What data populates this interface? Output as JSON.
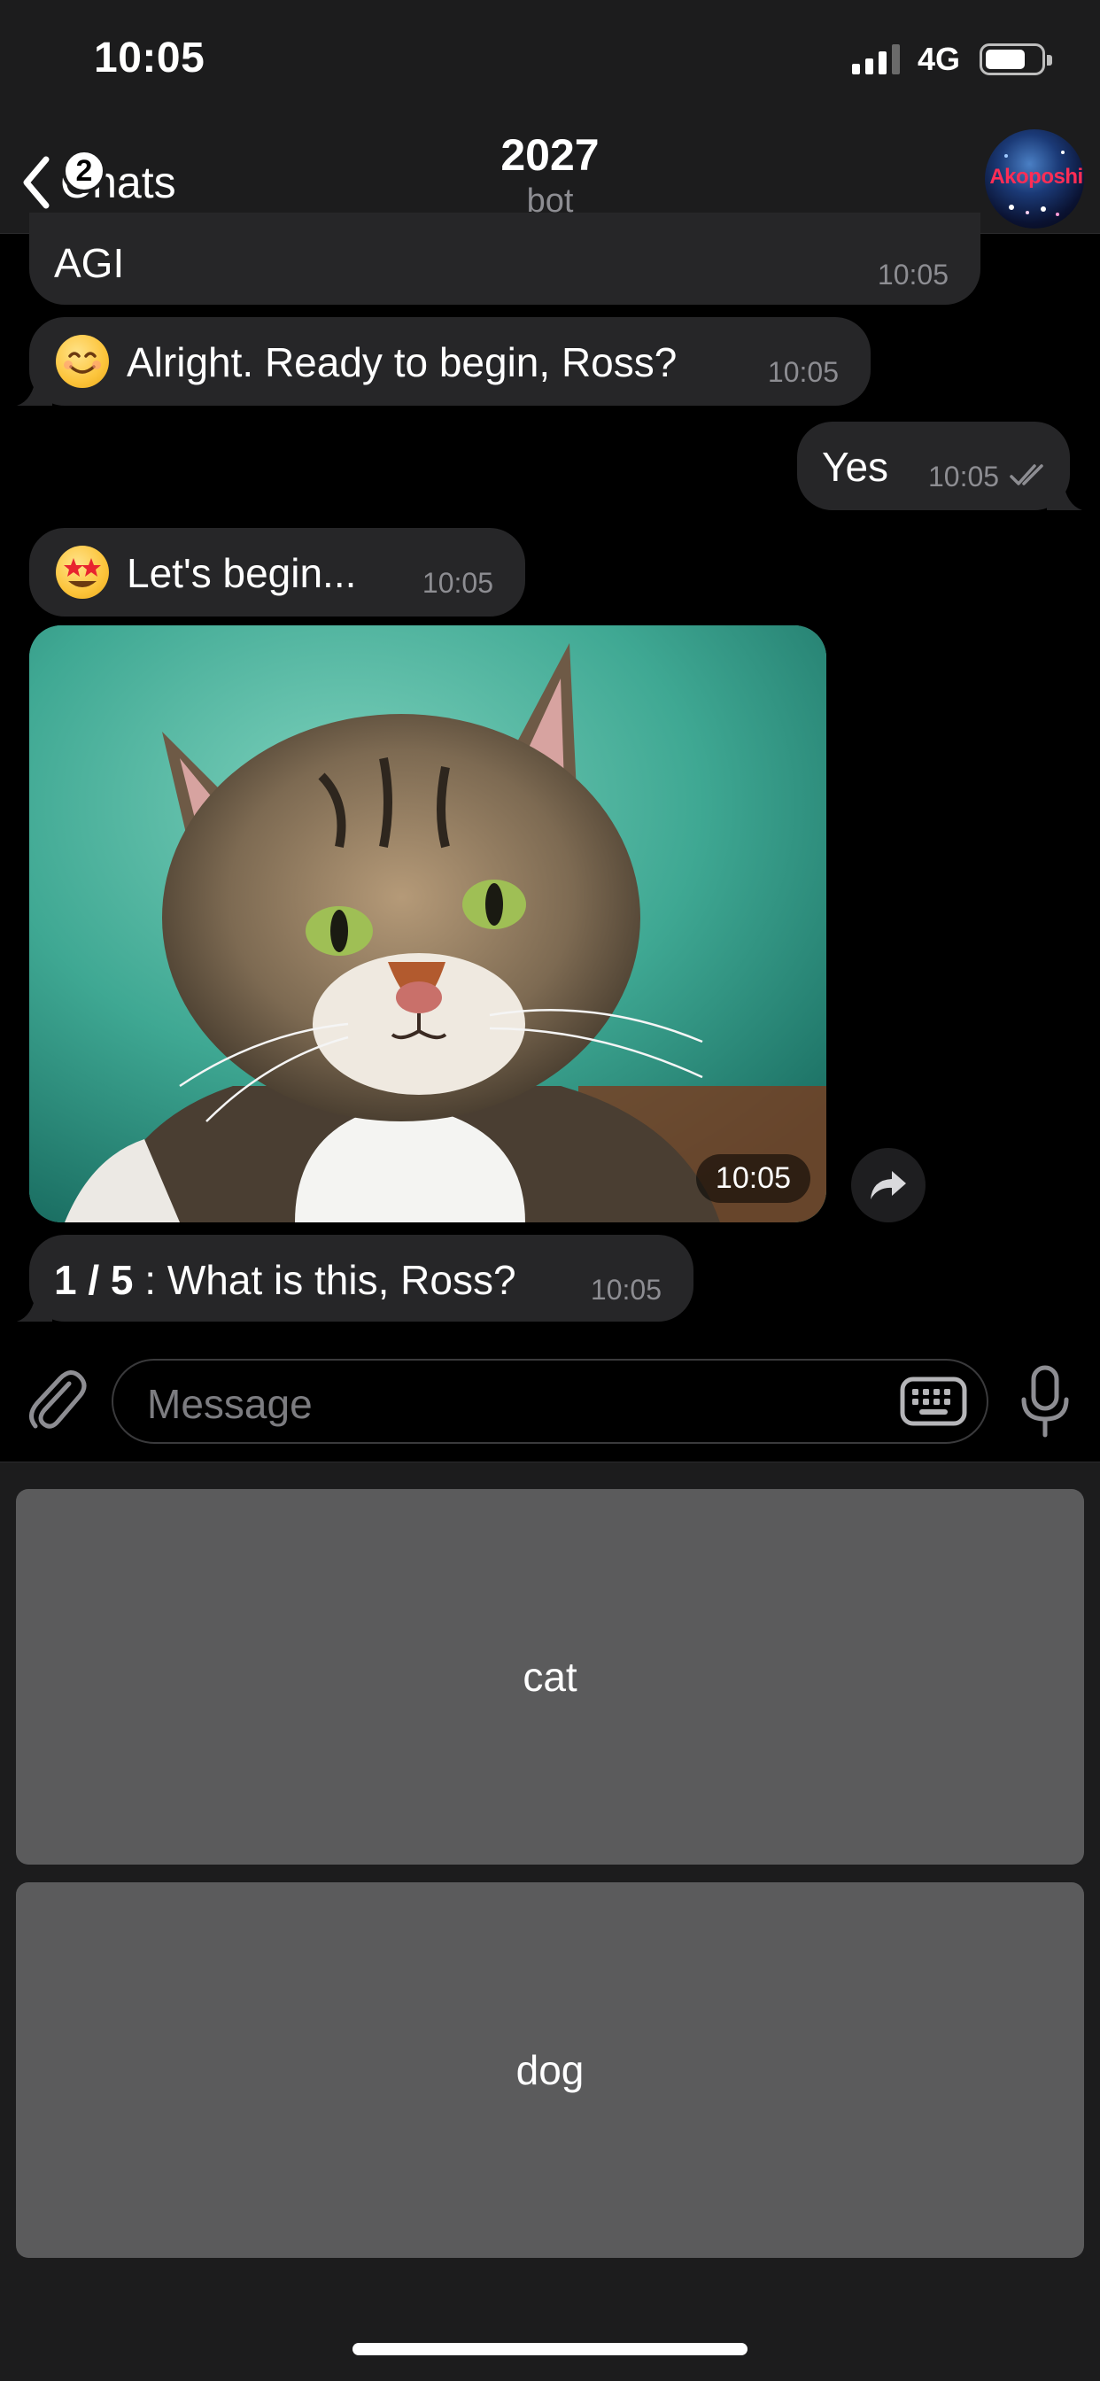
{
  "status_bar": {
    "time": "10:05",
    "network": "4G"
  },
  "nav": {
    "back_label": "Chats",
    "unread_badge": "2",
    "title": "2027",
    "subtitle": "bot",
    "avatar_text": "Akoposhi"
  },
  "messages": [
    {
      "text": "AGI",
      "time": "10:05",
      "direction": "in"
    },
    {
      "text": "Alright. Ready to begin, Ross?",
      "time": "10:05",
      "direction": "in",
      "emoji": "smiling-face-icon"
    },
    {
      "text": "Yes",
      "time": "10:05",
      "direction": "out",
      "status": "read"
    },
    {
      "text": "Let's begin...",
      "time": "10:05",
      "direction": "in",
      "emoji": "star-struck-face-icon"
    },
    {
      "type": "photo",
      "subject": "cat",
      "time": "10:05",
      "direction": "in"
    },
    {
      "prefix": "1 / 5",
      "text": " : What is this, Ross?",
      "time": "10:05",
      "direction": "in"
    }
  ],
  "input": {
    "placeholder": "Message"
  },
  "keyboard": {
    "buttons": [
      "cat",
      "dog"
    ]
  },
  "colors": {
    "bubble_in": "#262628",
    "bubble_out": "#262628",
    "keyboard_button": "#5b5b5c",
    "bar_bg": "#1c1c1d"
  }
}
